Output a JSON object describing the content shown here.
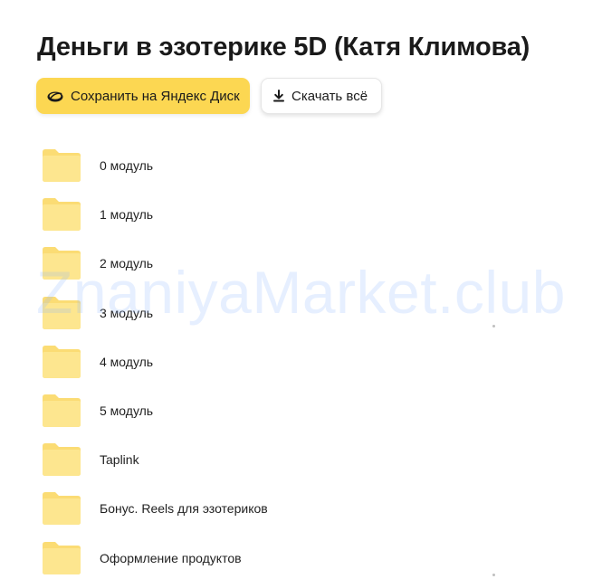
{
  "page": {
    "title": "Деньги в эзотерике 5D (Катя Климова)"
  },
  "toolbar": {
    "save_label": "Сохранить на Яндекс Диск",
    "save_icon": "yandex-disk-icon",
    "download_label": "Скачать всё",
    "download_icon": "download-icon"
  },
  "folders": [
    {
      "name": "0 модуль",
      "icon": "folder-icon"
    },
    {
      "name": "1 модуль",
      "icon": "folder-icon"
    },
    {
      "name": "2 модуль",
      "icon": "folder-icon"
    },
    {
      "name": "3 модуль",
      "icon": "folder-icon"
    },
    {
      "name": "4 модуль",
      "icon": "folder-icon"
    },
    {
      "name": "5 модуль",
      "icon": "folder-icon"
    },
    {
      "name": "Taplink",
      "icon": "folder-icon"
    },
    {
      "name": "Бонус. Reels для эзотериков",
      "icon": "folder-icon"
    },
    {
      "name": "Оформление продуктов",
      "icon": "folder-icon"
    }
  ],
  "watermark": "ZnaniyaMarket.club",
  "colors": {
    "accent_yellow": "#fcd752",
    "folder_fill": "#fde68f",
    "folder_tab": "#fbdc74",
    "text": "#1f1f1f"
  }
}
